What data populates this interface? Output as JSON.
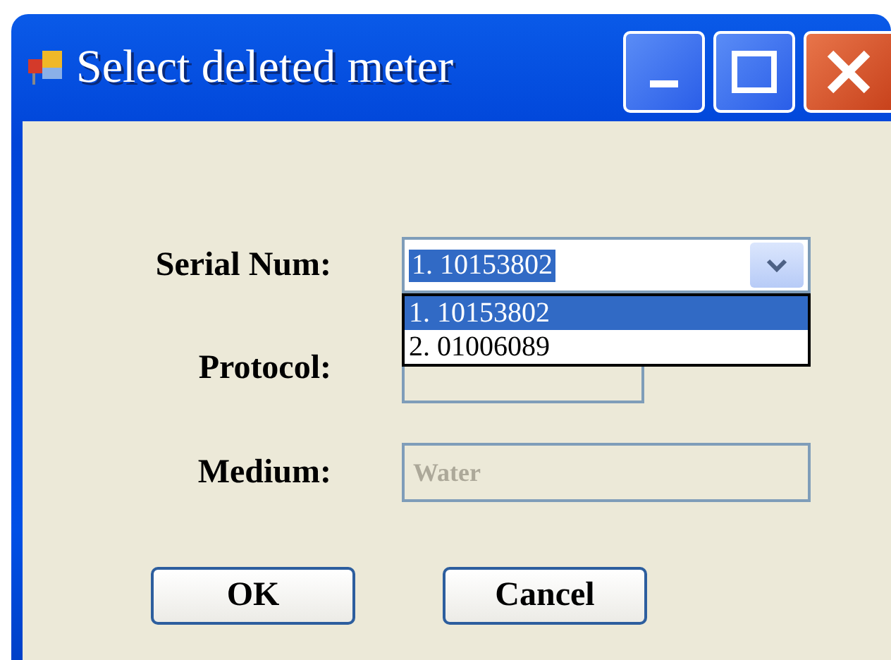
{
  "window": {
    "title": "Select deleted meter"
  },
  "fields": [
    {
      "label": "Serial Num:",
      "kind": "combo",
      "value": "1. 10153802",
      "expanded": true,
      "options": [
        {
          "text": "1. 10153802",
          "selected": true
        },
        {
          "text": "2. 01006089",
          "selected": false
        }
      ]
    },
    {
      "label": "Protocol:",
      "kind": "text",
      "disabled": true
    },
    {
      "label": "Medium:",
      "kind": "text",
      "value": "Water",
      "disabled": true
    }
  ],
  "buttons": [
    "OK",
    "Cancel"
  ]
}
